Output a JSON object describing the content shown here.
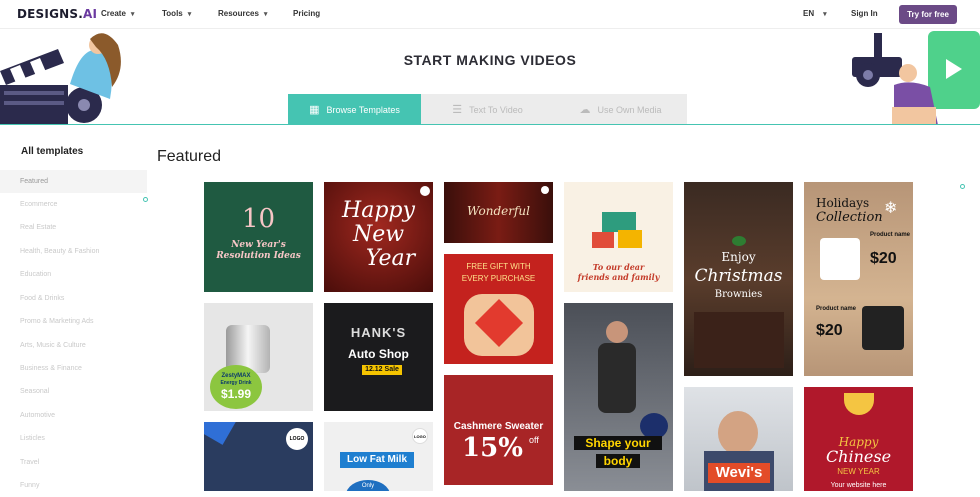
{
  "nav": {
    "logo_main": "DESIGNS.",
    "logo_ai": "AI",
    "items": [
      {
        "label": "Create",
        "chevron": "▾"
      },
      {
        "label": "Tools",
        "chevron": "▾"
      },
      {
        "label": "Resources",
        "chevron": "▾"
      },
      {
        "label": "Pricing",
        "chevron": ""
      }
    ],
    "language": "EN",
    "language_chevron": "▾",
    "sign_in": "Sign In",
    "try_free": "Try for free"
  },
  "hero": {
    "title": "START MAKING VIDEOS",
    "tabs": [
      {
        "label": "Browse Templates",
        "icon": "grid-icon"
      },
      {
        "label": "Text To Video",
        "icon": "document-icon"
      },
      {
        "label": "Use Own Media",
        "icon": "cloud-upload-icon"
      }
    ]
  },
  "sidebar": {
    "title": "All templates",
    "items": [
      "Featured",
      "Ecommerce",
      "Real Estate",
      "Health, Beauty & Fashion",
      "Education",
      "Food & Drinks",
      "Promo & Marketing Ads",
      "Arts, Music & Culture",
      "Business & Finance",
      "Seasonal",
      "Automotive",
      "Listicles",
      "Travel",
      "Funny"
    ]
  },
  "main": {
    "heading": "Featured",
    "cards": {
      "c1_num": "10",
      "c1_text": "New Year's Resolution Ideas",
      "c2_line1": "Happy",
      "c2_line2": "New",
      "c2_line3": "Year",
      "c3_text": "Wonderful",
      "c4_line1": "FREE GIFT WITH",
      "c4_line2": "EVERY PURCHASE",
      "c5_line1": "Cashmere Sweater",
      "c5_pct": "15%",
      "c5_off": "off",
      "c6_line1": "To our dear",
      "c6_line2": "friends and family",
      "c7_cap1": "Shape your",
      "c7_cap2": "body",
      "c8_line1": "Enjoy",
      "c8_line2": "Christmas",
      "c8_line3": "Brownies",
      "c9_name": "Wevi's",
      "c10_title1": "Holidays",
      "c10_title2": "Collection",
      "c10_label": "Product name",
      "c10_price1": "$20",
      "c10_price2": "$20",
      "c11_line1": "Happy",
      "c11_line2": "Chinese",
      "c11_line3": "NEW YEAR",
      "c11_line4": "Your website here",
      "c12_brand": "ZestyMAX",
      "c12_sub": "Energy Drink",
      "c12_price": "$1.99",
      "c13_line1": "HANK'S",
      "c13_line2": "Auto Shop",
      "c13_badge": "12.12 Sale",
      "c14_logo": "LOGO",
      "c15_title": "Low Fat Milk",
      "c15_logo": "LOGO",
      "c15_badge": "Only"
    }
  }
}
